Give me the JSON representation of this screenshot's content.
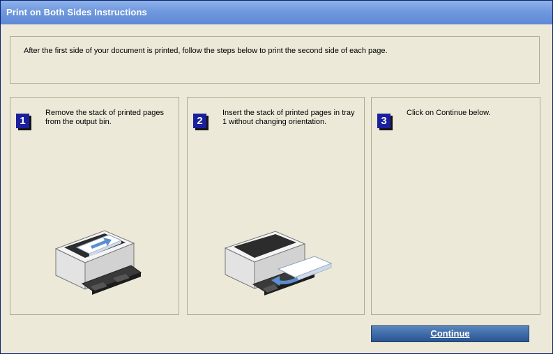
{
  "window": {
    "title": "Print on Both Sides Instructions"
  },
  "intro": {
    "text": "After the first side of your document is printed, follow the steps below to print the second side of each page."
  },
  "steps": [
    {
      "number": "1",
      "text": "Remove the stack of printed pages from the output bin.",
      "illustration": "printer-output-bin-icon"
    },
    {
      "number": "2",
      "text": "Insert the stack of printed pages in tray 1 without changing orientation.",
      "illustration": "printer-input-tray-icon"
    },
    {
      "number": "3",
      "text": "Click on Continue below."
    }
  ],
  "buttons": {
    "continue_label": "Continue"
  },
  "colors": {
    "titlebar": "#6f98de",
    "badge": "#1a1f9e",
    "button": "#3d6aa7",
    "background": "#ece9d8"
  }
}
